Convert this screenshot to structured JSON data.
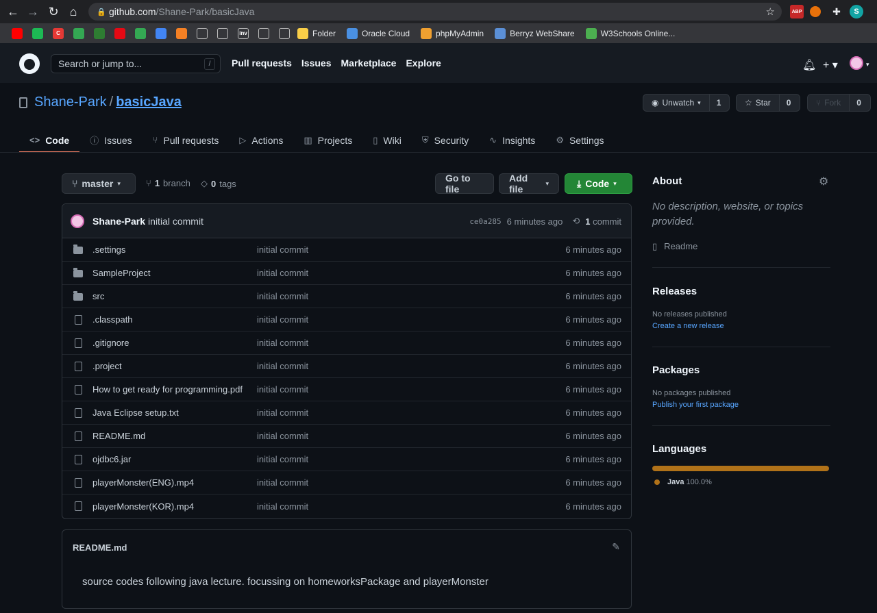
{
  "browser": {
    "url_host": "github.com",
    "url_path": "/Shane-Park/basicJava",
    "profile_initial": "S",
    "ext_abp": "ABP",
    "bookmarks": [
      {
        "label": "Folder",
        "icon": "folder-icon",
        "color": "#f9ce48"
      },
      {
        "label": "Oracle Cloud",
        "icon": "cloud-icon",
        "color": "#4a90e2"
      },
      {
        "label": "phpMyAdmin",
        "icon": "phpmyadmin-icon",
        "color": "#f0a030"
      },
      {
        "label": "Berryz WebShare",
        "icon": "berryz-icon",
        "color": "#5b8fd6"
      },
      {
        "label": "W3Schools Online...",
        "icon": "w3schools-icon",
        "color": "#4caf50"
      }
    ],
    "bookmark_icon_colors": [
      "#ff0000",
      "#1db954",
      "#e53935",
      "#34a853",
      "#2e7d32",
      "#e50914",
      "#34a853",
      "#4285f4",
      "#f48024",
      "#ffffff",
      "#ffffff",
      "#ffffff",
      "#ffffff",
      "#ffffff"
    ],
    "bookmark_icon_text": [
      "",
      "",
      "C",
      "",
      "",
      "",
      "",
      "",
      "",
      "",
      "",
      "inv",
      "",
      ""
    ]
  },
  "header": {
    "search_placeholder": "Search or jump to...",
    "search_key": "/",
    "nav": [
      "Pull requests",
      "Issues",
      "Marketplace",
      "Explore"
    ]
  },
  "repo": {
    "owner": "Shane-Park",
    "separator": "/",
    "name": "basicJava",
    "unwatch_label": "Unwatch",
    "unwatch_count": "1",
    "star_label": "Star",
    "star_count": "0",
    "fork_label": "Fork",
    "fork_count": "0"
  },
  "tabs": [
    {
      "label": "Code",
      "icon": "code-icon",
      "glyph": "<>",
      "active": true
    },
    {
      "label": "Issues",
      "icon": "issue-icon",
      "glyph": "ⓘ",
      "active": false
    },
    {
      "label": "Pull requests",
      "icon": "pull-request-icon",
      "glyph": "⑂",
      "active": false
    },
    {
      "label": "Actions",
      "icon": "play-icon",
      "glyph": "▷",
      "active": false
    },
    {
      "label": "Projects",
      "icon": "project-icon",
      "glyph": "▥",
      "active": false
    },
    {
      "label": "Wiki",
      "icon": "book-icon",
      "glyph": "▯",
      "active": false
    },
    {
      "label": "Security",
      "icon": "shield-icon",
      "glyph": "⛨",
      "active": false
    },
    {
      "label": "Insights",
      "icon": "graph-icon",
      "glyph": "∿",
      "active": false
    },
    {
      "label": "Settings",
      "icon": "gear-icon",
      "glyph": "⚙",
      "active": false
    }
  ],
  "toolbar": {
    "branch": "master",
    "branch_count": "1",
    "branch_label": "branch",
    "tag_count": "0",
    "tag_label": "tags",
    "go_to_file": "Go to file",
    "add_file": "Add file",
    "code": "Code"
  },
  "commit": {
    "author": "Shane-Park",
    "message": "initial commit",
    "sha": "ce0a285",
    "age": "6 minutes ago",
    "count": "1",
    "count_label": "commit"
  },
  "files": [
    {
      "name": ".settings",
      "type": "folder",
      "message": "initial commit",
      "age": "6 minutes ago"
    },
    {
      "name": "SampleProject",
      "type": "folder",
      "message": "initial commit",
      "age": "6 minutes ago"
    },
    {
      "name": "src",
      "type": "folder",
      "message": "initial commit",
      "age": "6 minutes ago"
    },
    {
      "name": ".classpath",
      "type": "file",
      "message": "initial commit",
      "age": "6 minutes ago"
    },
    {
      "name": ".gitignore",
      "type": "file",
      "message": "initial commit",
      "age": "6 minutes ago"
    },
    {
      "name": ".project",
      "type": "file",
      "message": "initial commit",
      "age": "6 minutes ago"
    },
    {
      "name": "How to get ready for programming.pdf",
      "type": "file",
      "message": "initial commit",
      "age": "6 minutes ago"
    },
    {
      "name": "Java Eclipse setup.txt",
      "type": "file",
      "message": "initial commit",
      "age": "6 minutes ago"
    },
    {
      "name": "README.md",
      "type": "file",
      "message": "initial commit",
      "age": "6 minutes ago"
    },
    {
      "name": "ojdbc6.jar",
      "type": "file",
      "message": "initial commit",
      "age": "6 minutes ago"
    },
    {
      "name": "playerMonster(ENG).mp4",
      "type": "file",
      "message": "initial commit",
      "age": "6 minutes ago"
    },
    {
      "name": "playerMonster(KOR).mp4",
      "type": "file",
      "message": "initial commit",
      "age": "6 minutes ago"
    }
  ],
  "readme": {
    "title": "README.md",
    "body": "source codes following java lecture. focussing on homeworksPackage and playerMonster"
  },
  "sidebar": {
    "about_title": "About",
    "about_desc": "No description, website, or topics provided.",
    "readme_link": "Readme",
    "releases_title": "Releases",
    "releases_empty": "No releases published",
    "releases_link": "Create a new release",
    "packages_title": "Packages",
    "packages_empty": "No packages published",
    "packages_link": "Publish your first package",
    "languages_title": "Languages",
    "language_name": "Java",
    "language_pct": "100.0%",
    "language_color": "#b07219"
  }
}
